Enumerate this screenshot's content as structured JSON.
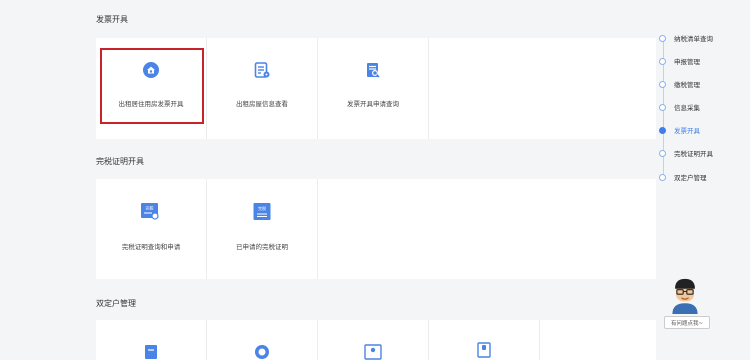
{
  "sections": [
    {
      "title": "发票开具",
      "cards": [
        {
          "label": "出租居住用房发票开具",
          "icon": "house-coin-icon"
        },
        {
          "label": "出租房屋信息查看",
          "icon": "document-settings-icon"
        },
        {
          "label": "发票开具申请查询",
          "icon": "document-search-icon"
        }
      ]
    },
    {
      "title": "完税证明开具",
      "cards": [
        {
          "label": "完税证明查询和申请",
          "icon": "tax-certificate-search-icon",
          "badge": "完税"
        },
        {
          "label": "已申请的完税证明",
          "icon": "tax-certificate-icon",
          "badge": "完税"
        }
      ]
    },
    {
      "title": "双定户管理",
      "cards": [
        {
          "label": "",
          "icon": "document-icon"
        },
        {
          "label": "",
          "icon": "circle-icon"
        },
        {
          "label": "",
          "icon": "certificate-icon"
        },
        {
          "label": "",
          "icon": "id-card-icon"
        }
      ]
    }
  ],
  "nav": {
    "items": [
      "纳税清单查询",
      "申报管理",
      "缴税管理",
      "信息采集",
      "发票开具",
      "完税证明开具",
      "双定户管理"
    ],
    "active": "发票开具"
  },
  "helper": {
    "text": "有问题点我~"
  },
  "colors": {
    "accent": "#3f7de8",
    "highlight": "#c8222a",
    "icon_blue": "#4a84e6"
  }
}
